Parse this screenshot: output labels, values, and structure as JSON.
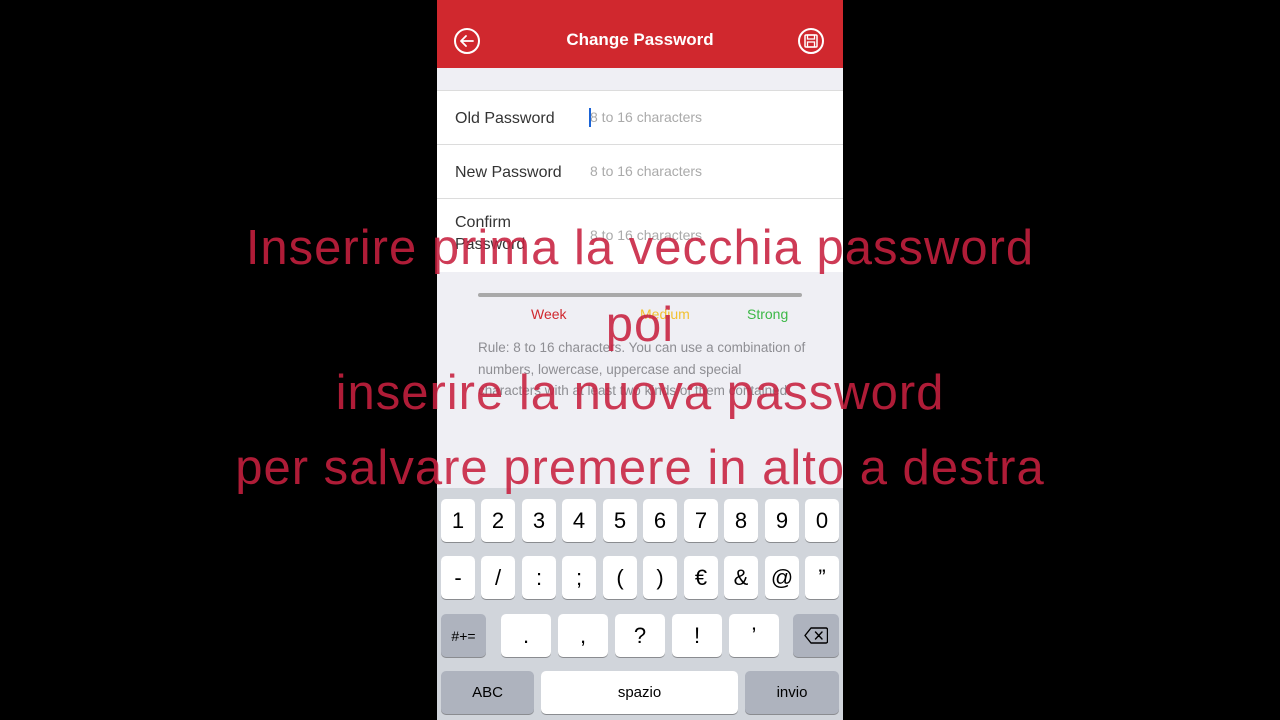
{
  "navbar": {
    "title": "Change Password",
    "back_icon": "arrow-left-icon",
    "save_icon": "floppy-disk-icon"
  },
  "form": {
    "old_password": {
      "label": "Old Password",
      "placeholder": "8 to 16 characters"
    },
    "new_password": {
      "label": "New Password",
      "placeholder": "8 to 16 characters"
    },
    "confirm_password": {
      "label": "Confirm\nPassword",
      "placeholder": "8 to 16 characters"
    }
  },
  "strength": {
    "weak": "Week",
    "medium": "Medium",
    "strong": "Strong",
    "colors": {
      "weak": "#d0282e",
      "medium": "#f2c230",
      "strong": "#3cb846"
    }
  },
  "rule_text": "Rule: 8 to 16 characters. You can use a combination of numbers, lowercase, uppercase and special characters with at least two kinds of them contained.",
  "keyboard": {
    "row1": [
      "1",
      "2",
      "3",
      "4",
      "5",
      "6",
      "7",
      "8",
      "9",
      "0"
    ],
    "row2": [
      "-",
      "/",
      ":",
      ";",
      "(",
      ")",
      "€",
      "&",
      "@",
      "”"
    ],
    "row3": [
      ".",
      ",",
      "?",
      "!",
      "’"
    ],
    "symbols_key": "#+=",
    "abc_key": "ABC",
    "space_key": "spazio",
    "return_key": "invio",
    "delete_icon": "backspace-icon"
  },
  "overlay": {
    "line1": "Inserire prima la vecchia password",
    "line2": "poi",
    "line3": "inserire la nuova password",
    "line4": "per salvare premere in alto a destra"
  },
  "colors": {
    "accent": "#d0282e",
    "background": "#efeff4"
  }
}
